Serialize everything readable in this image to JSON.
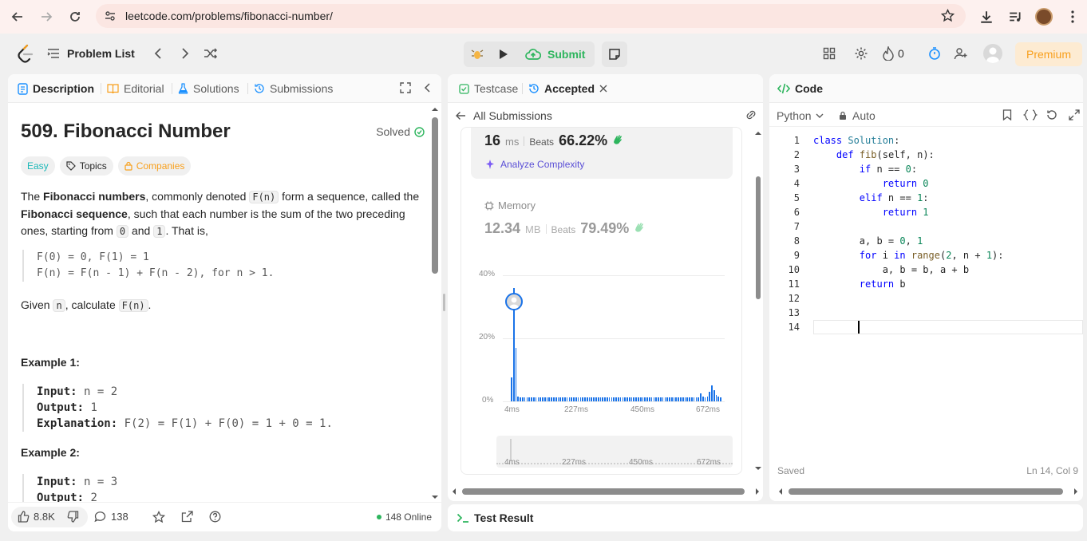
{
  "browser": {
    "url": "leetcode.com/problems/fibonacci-number/"
  },
  "topnav": {
    "problem_list": "Problem List",
    "submit": "Submit",
    "streak": "0",
    "premium": "Premium"
  },
  "left_tabs": {
    "description": "Description",
    "editorial": "Editorial",
    "solutions": "Solutions",
    "submissions": "Submissions"
  },
  "problem": {
    "title": "509. Fibonacci Number",
    "status": "Solved",
    "difficulty": "Easy",
    "topics": "Topics",
    "companies": "Companies",
    "p1_a": "The ",
    "p1_b": "Fibonacci numbers",
    "p1_c": ", commonly denoted ",
    "p1_code": "F(n)",
    "p1_d": " form a sequence, called the ",
    "p1_e": "Fibonacci sequence",
    "p1_f": ", such that each number is the sum of the two preceding ones, starting from ",
    "p1_code0": "0",
    "p1_g": " and ",
    "p1_code1": "1",
    "p1_h": ". That is,",
    "formula1": "F(0) = 0, F(1) = 1",
    "formula2": "F(n) = F(n - 1) + F(n - 2), for n > 1.",
    "given_a": "Given ",
    "given_code": "n",
    "given_b": ", calculate ",
    "given_code2": "F(n)",
    "given_c": ".",
    "ex1_title": "Example 1:",
    "ex1_input_label": "Input:",
    "ex1_input": "n = 2",
    "ex1_output_label": "Output:",
    "ex1_output": "1",
    "ex1_expl_label": "Explanation:",
    "ex1_expl": "F(2) = F(1) + F(0) = 1 + 0 = 1.",
    "ex2_title": "Example 2:",
    "ex2_input_label": "Input:",
    "ex2_input": "n = 3",
    "ex2_output_label": "Output:",
    "ex2_output": "2"
  },
  "left_footer": {
    "likes": "8.8K",
    "comments": "138",
    "online": "148 Online"
  },
  "mid_tabs": {
    "testcase": "Testcase",
    "accepted": "Accepted"
  },
  "submission": {
    "back": "All Submissions",
    "runtime_value": "16",
    "runtime_unit": "ms",
    "beats_label": "Beats",
    "runtime_beats": "66.22%",
    "analyze": "Analyze Complexity",
    "memory_label": "Memory",
    "memory_value": "12.34",
    "memory_unit": "MB",
    "memory_beats_label": "Beats",
    "memory_beats": "79.49%"
  },
  "chart_data": {
    "type": "bar",
    "ylim": [
      0,
      40
    ],
    "yticks": [
      "40%",
      "20%",
      "0%"
    ],
    "xticks": [
      "4ms",
      "227ms",
      "450ms",
      "672ms"
    ],
    "values": [
      7.5,
      36,
      17,
      1.5,
      1.2,
      1.2,
      1.2,
      1.2,
      1.2,
      1.2,
      1.2,
      1.2,
      1.2,
      1.2,
      1.2,
      1.2,
      1.2,
      1.2,
      1.2,
      1.2,
      1.2,
      1.2,
      1.2,
      1.2,
      1.2,
      1.2,
      1.2,
      1.2,
      1.2,
      1.2,
      1.2,
      1.2,
      1.2,
      1.2,
      1.2,
      1.2,
      1.2,
      1.2,
      1.2,
      1.2,
      1.2,
      1.2,
      1.2,
      1.2,
      1.2,
      1.2,
      1.2,
      1.2,
      1.2,
      1.2,
      1.2,
      1.2,
      1.2,
      1.2,
      1.2,
      1.2,
      1.2,
      1.2,
      1.2,
      1.2,
      1.2,
      1.2,
      1.2,
      1.2,
      1.2,
      1.2,
      1.2,
      1.2,
      1.2,
      1.2,
      1.2,
      1.2,
      1.2,
      1.2,
      1.2,
      1.2,
      1.2,
      1.2,
      1.2,
      1.2,
      1.2,
      1.2,
      1.2,
      1.2,
      1.2,
      2.5,
      1.5,
      1.2,
      1.5,
      3,
      5,
      3.5,
      2,
      1.5,
      1.2
    ],
    "highlight_index": 1,
    "color": "#1a73e8"
  },
  "code_panel": {
    "title": "Code",
    "language": "Python",
    "auto": "Auto",
    "saved": "Saved",
    "cursor": "Ln 14, Col 9",
    "line_numbers": [
      "1",
      "2",
      "3",
      "4",
      "5",
      "6",
      "7",
      "8",
      "9",
      "10",
      "11",
      "12",
      "13",
      "14"
    ]
  },
  "test_result": {
    "title": "Test Result"
  }
}
